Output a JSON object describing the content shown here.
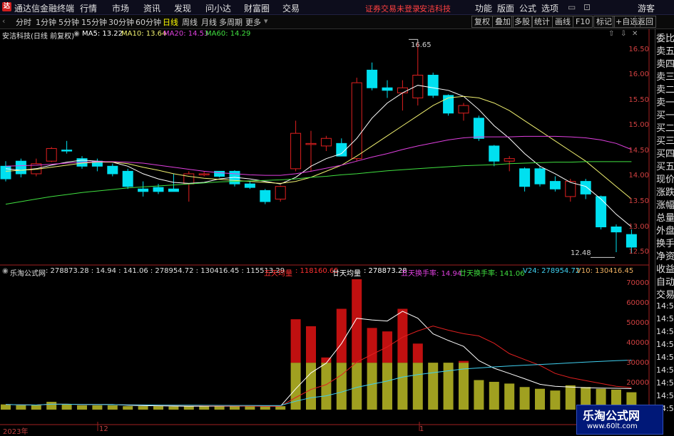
{
  "titlebar": {
    "app_title": "通达信金融终端",
    "menus": [
      "行情",
      "市场",
      "资讯",
      "发现",
      "问小达",
      "财富圈",
      "交易"
    ],
    "notice": "证券交易未登录",
    "stock": "安洁科技",
    "right_menus": [
      "功能",
      "版面",
      "公式",
      "选项"
    ],
    "user": "游客"
  },
  "toolbar": {
    "periods": [
      "分时",
      "1分钟",
      "5分钟",
      "15分钟",
      "30分钟",
      "60分钟",
      "日线",
      "周线",
      "月线",
      "多周期",
      "更多"
    ],
    "active_period": "日线",
    "right_buttons": [
      "复权",
      "叠加",
      "多股",
      "统计",
      "画线",
      "F10",
      "标记",
      "+自选",
      "返回"
    ]
  },
  "main_info": {
    "title": "安洁科技(日线 前复权)",
    "ma5": "MA5: 13.22",
    "ma10": "MA10: 13.64",
    "ma20": "MA20: 14.53",
    "ma60": "MA60: 14.29"
  },
  "vol_info": {
    "title": "乐淘公式网",
    "vals": ": 278873.28 : 14.94 : 141.06 : 278954.72 : 130416.45 : 115513.29",
    "wu_label": "五天均量",
    "wu_val": ": 118160.65",
    "nian_label": "廿天均量",
    "nian_val": ": 278873.28",
    "wu_hs": "五天换手率: 14.94",
    "nian_hs": "廿天换手率: 141.06",
    "v24": "V24: 278954.72",
    "v10": "V10: 130416.45"
  },
  "right_panel": {
    "items": [
      "委比",
      "卖五",
      "卖四",
      "卖三",
      "卖二",
      "卖一",
      "买一",
      "买二",
      "买三",
      "买四",
      "买五",
      "现价",
      "涨跌",
      "涨幅",
      "总量",
      "外盘",
      "换手",
      "净资",
      "收益",
      "自动",
      "交易",
      "14:56",
      "14:56",
      "14:56",
      "14:56",
      "14:56",
      "14:56",
      "14:56",
      "14:56",
      "14:56"
    ]
  },
  "price_axis": [
    "16.50",
    "16.00",
    "15.50",
    "15.00",
    "14.50",
    "14.00",
    "13.50",
    "13.00",
    "12.50"
  ],
  "vol_axis": [
    "70000",
    "60000",
    "50000",
    "40000",
    "30000",
    "20000"
  ],
  "date_axis": [
    "2023年",
    "12",
    "1"
  ],
  "annotations": {
    "high": "16.65",
    "low": "12.48"
  },
  "watermark": {
    "name": "乐淘公式网",
    "url": "www.60lt.com"
  },
  "colors": {
    "up": "#e02020",
    "down": "#00e0f0",
    "ma5": "#ffffff",
    "ma10": "#f0f070",
    "ma20": "#e040e0",
    "ma60": "#40e040",
    "vol_up": "#c01010",
    "vol_base": "#a0a020"
  },
  "chart_data": {
    "type": "candlestick",
    "ylim": [
      12.3,
      16.8
    ],
    "candles": [
      {
        "o": 14.2,
        "c": 13.95,
        "h": 14.3,
        "l": 13.9
      },
      {
        "o": 14.3,
        "c": 14.05,
        "h": 14.35,
        "l": 13.98
      },
      {
        "o": 14.05,
        "c": 14.25,
        "h": 14.35,
        "l": 14.0
      },
      {
        "o": 14.3,
        "c": 14.55,
        "h": 14.58,
        "l": 14.28
      },
      {
        "o": 14.52,
        "c": 14.5,
        "h": 14.7,
        "l": 14.45
      },
      {
        "o": 14.35,
        "c": 14.2,
        "h": 14.4,
        "l": 14.15
      },
      {
        "o": 14.3,
        "c": 14.2,
        "h": 14.35,
        "l": 14.1
      },
      {
        "o": 14.2,
        "c": 14.05,
        "h": 14.25,
        "l": 14.0
      },
      {
        "o": 14.1,
        "c": 13.8,
        "h": 14.15,
        "l": 13.75
      },
      {
        "o": 13.75,
        "c": 13.7,
        "h": 13.9,
        "l": 13.6
      },
      {
        "o": 13.78,
        "c": 13.7,
        "h": 13.85,
        "l": 13.65
      },
      {
        "o": 13.75,
        "c": 13.7,
        "h": 14.05,
        "l": 13.7
      },
      {
        "o": 13.85,
        "c": 14.05,
        "h": 14.1,
        "l": 13.5
      },
      {
        "o": 14.05,
        "c": 14.05,
        "h": 14.1,
        "l": 14.0
      },
      {
        "o": 14.1,
        "c": 14.0,
        "h": 14.1,
        "l": 13.98
      },
      {
        "o": 14.1,
        "c": 13.85,
        "h": 14.12,
        "l": 13.8
      },
      {
        "o": 13.85,
        "c": 13.78,
        "h": 13.9,
        "l": 13.75
      },
      {
        "o": 13.72,
        "c": 13.5,
        "h": 13.75,
        "l": 13.45
      },
      {
        "o": 13.55,
        "c": 13.8,
        "h": 13.82,
        "l": 13.5
      },
      {
        "o": 14.15,
        "c": 14.85,
        "h": 15.1,
        "l": 14.1
      },
      {
        "o": 14.65,
        "c": 14.65,
        "h": 14.9,
        "l": 14.1
      },
      {
        "o": 14.6,
        "c": 14.75,
        "h": 14.8,
        "l": 14.5
      },
      {
        "o": 14.65,
        "c": 14.4,
        "h": 14.75,
        "l": 14.4
      },
      {
        "o": 14.35,
        "c": 15.85,
        "h": 15.95,
        "l": 14.3
      },
      {
        "o": 16.1,
        "c": 15.75,
        "h": 16.25,
        "l": 15.7
      },
      {
        "o": 15.75,
        "c": 15.7,
        "h": 15.9,
        "l": 15.55
      },
      {
        "o": 15.65,
        "c": 15.75,
        "h": 15.9,
        "l": 15.3
      },
      {
        "o": 15.55,
        "c": 16.0,
        "h": 16.65,
        "l": 15.4
      },
      {
        "o": 16.0,
        "c": 15.6,
        "h": 16.05,
        "l": 15.55
      },
      {
        "o": 15.6,
        "c": 15.25,
        "h": 15.62,
        "l": 15.2
      },
      {
        "o": 15.25,
        "c": 15.4,
        "h": 15.45,
        "l": 15.1
      },
      {
        "o": 15.15,
        "c": 14.75,
        "h": 15.2,
        "l": 14.7
      },
      {
        "o": 14.6,
        "c": 14.3,
        "h": 14.62,
        "l": 14.2
      },
      {
        "o": 14.3,
        "c": 14.35,
        "h": 14.4,
        "l": 14.1
      },
      {
        "o": 14.15,
        "c": 13.8,
        "h": 14.18,
        "l": 13.7
      },
      {
        "o": 14.15,
        "c": 13.85,
        "h": 14.2,
        "l": 13.8
      },
      {
        "o": 13.9,
        "c": 13.75,
        "h": 14.0,
        "l": 13.7
      },
      {
        "o": 13.6,
        "c": 13.9,
        "h": 13.95,
        "l": 13.5
      },
      {
        "o": 13.9,
        "c": 13.65,
        "h": 13.95,
        "l": 13.55
      },
      {
        "o": 13.6,
        "c": 13.0,
        "h": 13.62,
        "l": 12.95
      },
      {
        "o": 13.0,
        "c": 12.9,
        "h": 13.05,
        "l": 12.5
      },
      {
        "o": 12.85,
        "c": 12.6,
        "h": 12.95,
        "l": 12.48
      }
    ],
    "ma5": [
      14.15,
      14.12,
      14.15,
      14.22,
      14.28,
      14.32,
      14.3,
      14.28,
      14.2,
      14.05,
      13.95,
      13.88,
      13.86,
      13.88,
      13.95,
      13.98,
      13.95,
      13.9,
      13.85,
      13.98,
      14.2,
      14.35,
      14.45,
      14.75,
      15.15,
      15.45,
      15.65,
      15.8,
      15.75,
      15.7,
      15.58,
      15.32,
      15.0,
      14.75,
      14.45,
      14.2,
      14.05,
      13.88,
      13.8,
      13.55,
      13.25,
      13.0
    ],
    "ma10": [
      14.1,
      14.12,
      14.14,
      14.18,
      14.22,
      14.26,
      14.28,
      14.28,
      14.25,
      14.18,
      14.12,
      14.05,
      14.0,
      13.96,
      13.94,
      13.92,
      13.9,
      13.88,
      13.86,
      13.9,
      13.98,
      14.1,
      14.22,
      14.4,
      14.6,
      14.8,
      15.0,
      15.2,
      15.4,
      15.55,
      15.58,
      15.55,
      15.45,
      15.3,
      15.1,
      14.9,
      14.7,
      14.5,
      14.3,
      14.05,
      13.8,
      13.55
    ],
    "ma20": [
      14.2,
      14.21,
      14.22,
      14.24,
      14.26,
      14.28,
      14.29,
      14.29,
      14.28,
      14.26,
      14.22,
      14.18,
      14.14,
      14.1,
      14.07,
      14.05,
      14.03,
      14.02,
      14.02,
      14.05,
      14.1,
      14.16,
      14.22,
      14.3,
      14.38,
      14.45,
      14.53,
      14.6,
      14.66,
      14.72,
      14.76,
      14.78,
      14.78,
      14.78,
      14.79,
      14.79,
      14.79,
      14.78,
      14.76,
      14.72,
      14.65,
      14.53
    ],
    "ma60": [
      13.45,
      13.5,
      13.55,
      13.6,
      13.64,
      13.68,
      13.71,
      13.74,
      13.77,
      13.79,
      13.81,
      13.83,
      13.85,
      13.87,
      13.89,
      13.9,
      13.91,
      13.92,
      13.93,
      13.95,
      13.98,
      14.0,
      14.03,
      14.05,
      14.08,
      14.11,
      14.13,
      14.15,
      14.17,
      14.19,
      14.21,
      14.22,
      14.23,
      14.25,
      14.26,
      14.27,
      14.28,
      14.28,
      14.29,
      14.29,
      14.29,
      14.29
    ],
    "volume_ylim": [
      0,
      75000
    ],
    "volume": [
      3000,
      2500,
      2500,
      4500,
      3000,
      2500,
      2500,
      2500,
      2000,
      2000,
      2000,
      1800,
      2000,
      2200,
      2000,
      2000,
      2000,
      1800,
      2000,
      52000,
      48000,
      30000,
      58000,
      75000,
      47000,
      45000,
      58000,
      38000,
      30000,
      28000,
      28000,
      17000,
      16000,
      15000,
      13000,
      12000,
      11000,
      14000,
      13000,
      12000,
      11500,
      10000
    ],
    "volume_up": [
      false,
      false,
      true,
      true,
      false,
      false,
      false,
      false,
      false,
      false,
      false,
      false,
      true,
      false,
      false,
      false,
      false,
      false,
      true,
      true,
      true,
      true,
      true,
      true,
      true,
      true,
      true,
      true,
      false,
      false,
      true,
      false,
      false,
      false,
      false,
      false,
      false,
      true,
      false,
      false,
      false,
      false
    ]
  }
}
